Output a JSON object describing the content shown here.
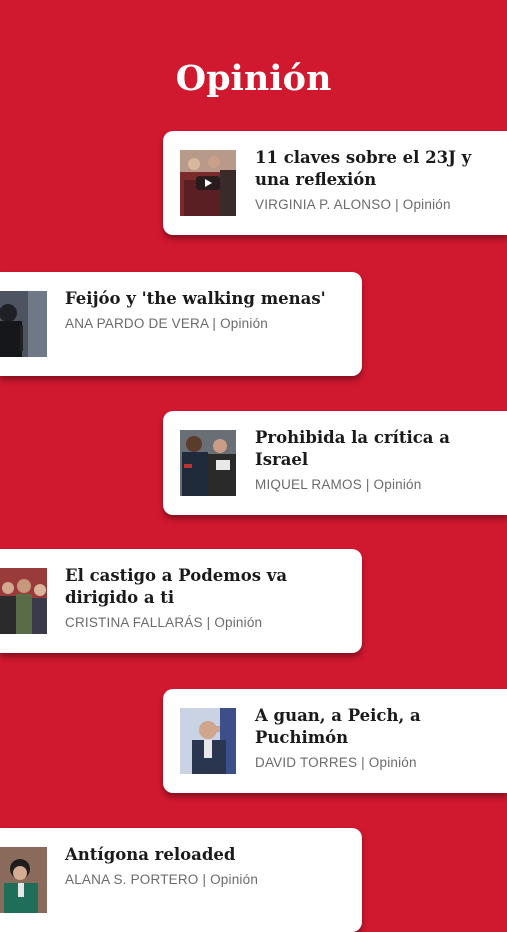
{
  "section_title": "Opinión",
  "articles": [
    {
      "headline": "11 claves sobre el 23J y una reflexión",
      "author": "VIRGINIA P. ALONSO",
      "separator": " | ",
      "category": "Opinión"
    },
    {
      "headline": "Feijóo y 'the walking menas'",
      "author": "ANA PARDO DE VERA",
      "separator": " | ",
      "category": "Opinión"
    },
    {
      "headline": "Prohibida la crítica a Israel",
      "author": "MIQUEL RAMOS",
      "separator": " | ",
      "category": "Opinión"
    },
    {
      "headline": "El castigo a Podemos va dirigido a ti",
      "author": "CRISTINA FALLARÁS",
      "separator": " | ",
      "category": "Opinión"
    },
    {
      "headline": "A guan, a Peich, a Puchimón",
      "author": "DAVID TORRES",
      "separator": " | ",
      "category": "Opinión"
    },
    {
      "headline": "Antígona reloaded",
      "author": "ALANA S. PORTERO",
      "separator": " | ",
      "category": "Opinión"
    }
  ],
  "colors": {
    "background": "#d0182f",
    "card": "#ffffff",
    "headline": "#1a1a1a",
    "byline": "#6b6b6b"
  }
}
